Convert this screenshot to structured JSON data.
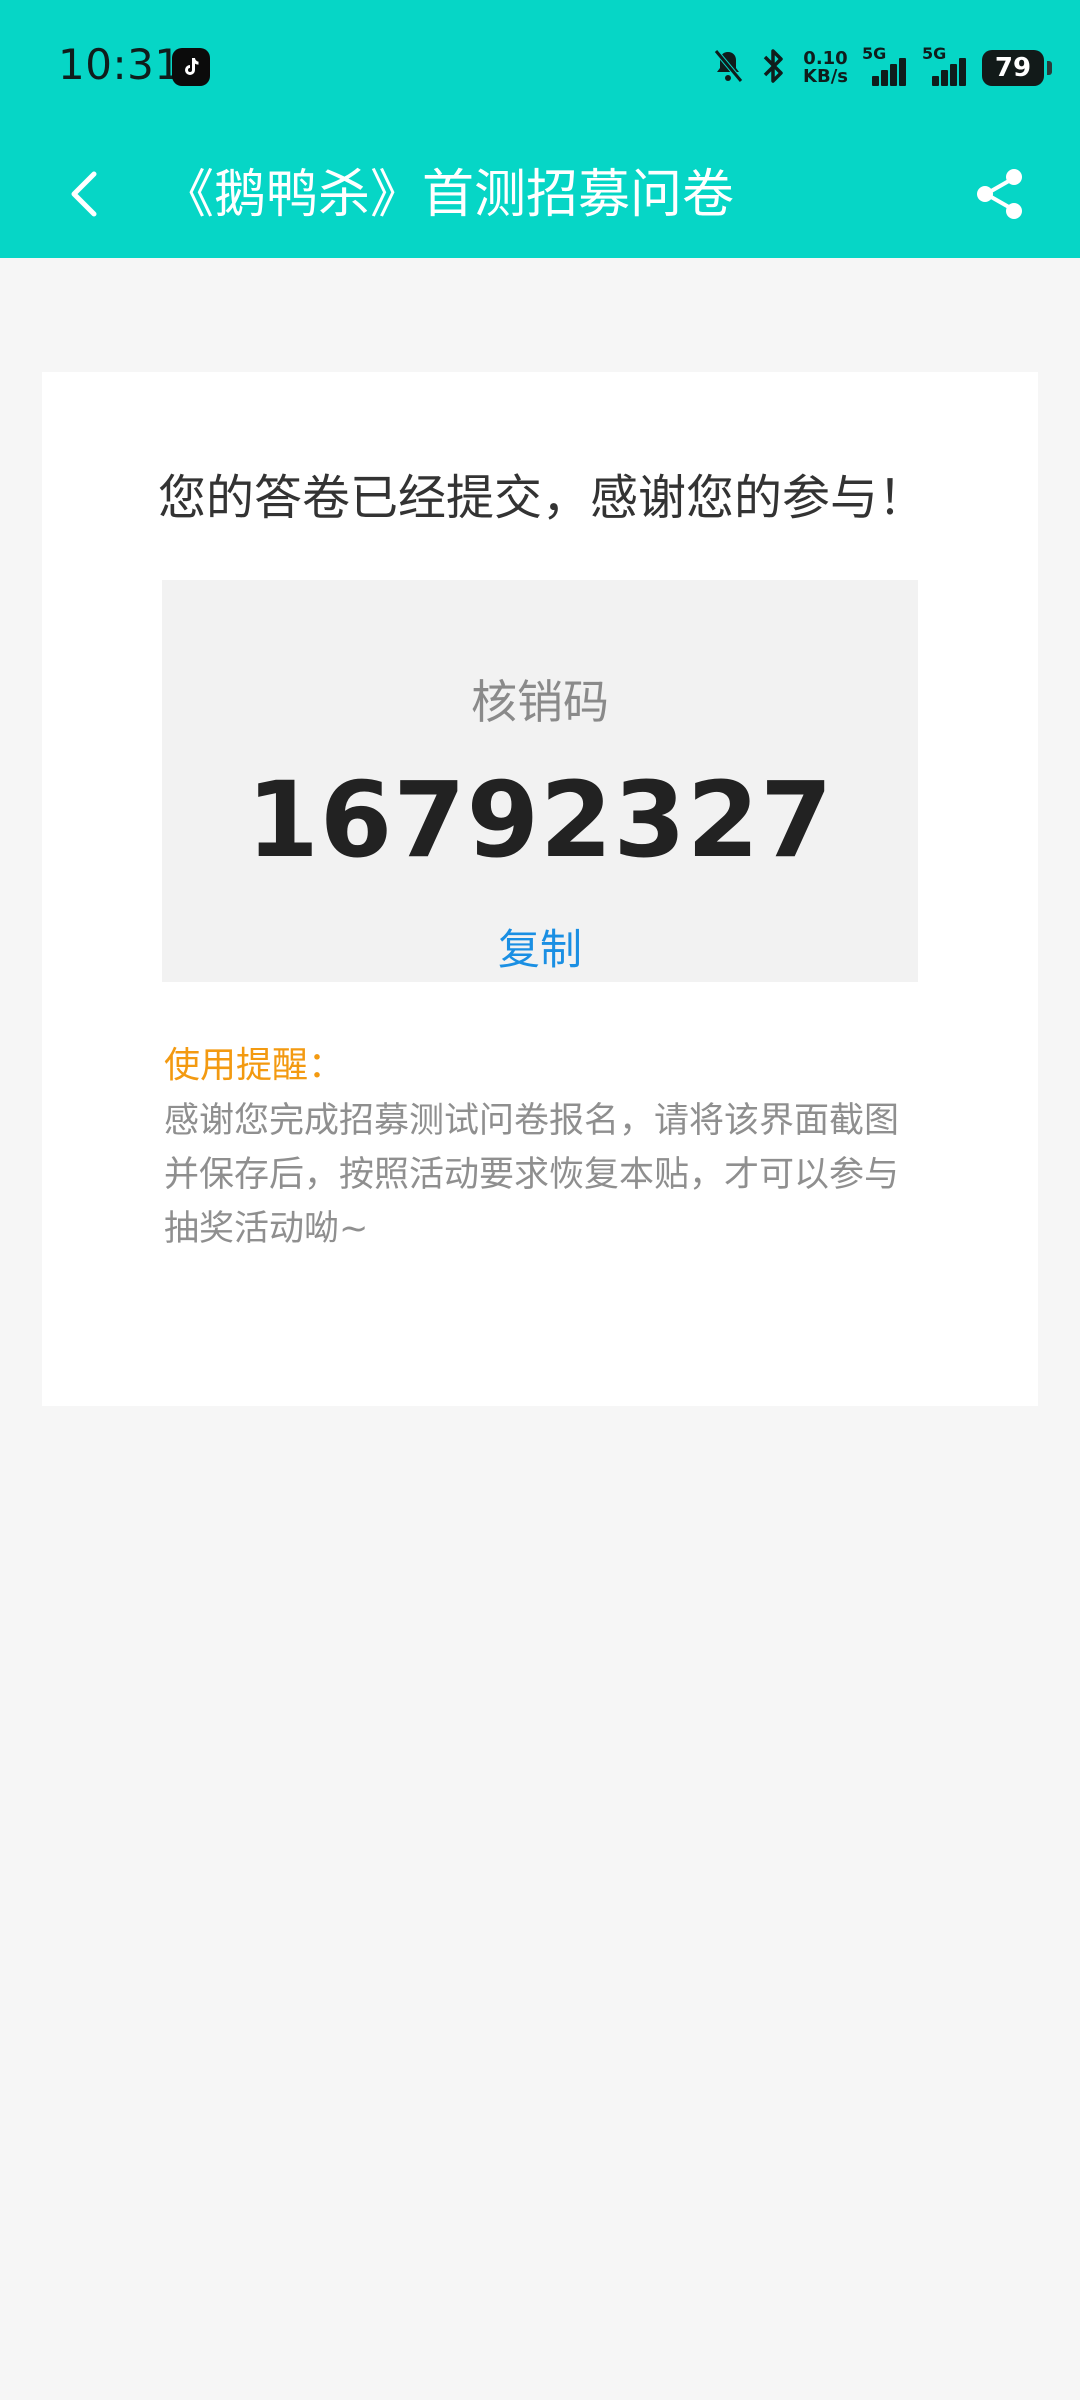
{
  "status_bar": {
    "time": "10:31",
    "net_speed_value": "0.10",
    "net_speed_unit": "KB/s",
    "sim1_label": "5G",
    "sim2_label": "5G",
    "battery": "79"
  },
  "header": {
    "title": "《鹅鸭杀》首测招募问卷"
  },
  "main": {
    "headline": "您的答卷已经提交，感谢您的参与！",
    "code_label": "核销码",
    "code_value": "16792327",
    "copy_label": "复制",
    "reminder_title": "使用提醒：",
    "reminder_text": "感谢您完成招募测试问卷报名，请将该界面截图并保存后，按照活动要求恢复本贴，才可以参与抽奖活动呦~"
  },
  "colors": {
    "appbar": "#06d6c6",
    "accent_blue": "#1a8fe3",
    "reminder_orange": "#f39a11"
  }
}
